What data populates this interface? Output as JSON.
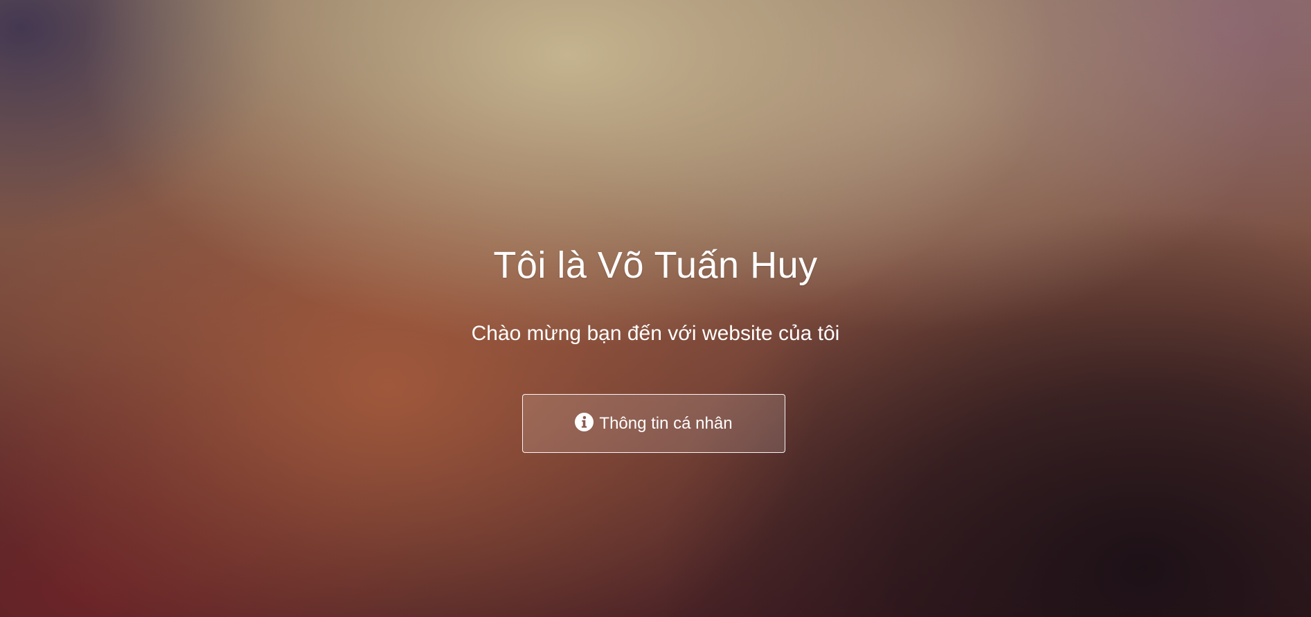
{
  "hero": {
    "title": "Tôi là Võ Tuấn Huy",
    "subtitle": "Chào mừng bạn đến với website của tôi",
    "button": {
      "label": "Thông tin cá nhân",
      "icon": "info-circle-icon"
    }
  },
  "colors": {
    "text": "#ffffff",
    "button_border": "#ffffff"
  }
}
